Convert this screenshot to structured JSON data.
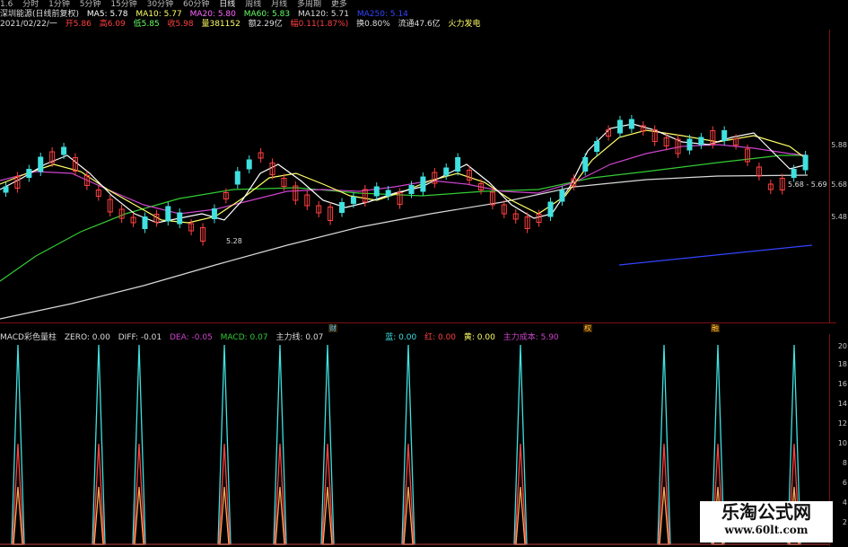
{
  "toolbar": {
    "items": [
      "1.6",
      "分时",
      "1分钟",
      "5分钟",
      "15分钟",
      "30分钟",
      "60分钟",
      "日线",
      "周线",
      "月线",
      "多周期",
      "更多"
    ]
  },
  "price_info": {
    "name": "深圳能源(日线前复权)",
    "ma5": "MA5: 5.78",
    "ma10": "MA10: 5.77",
    "ma20": "MA20: 5.80",
    "ma60": "MA60: 5.83",
    "ma120": "MA120: 5.71",
    "extra": "MA250: 5.14"
  },
  "quote_info": {
    "date": "2021/02/22/一",
    "open": "开5.86",
    "high": "高6.09",
    "low": "低5.85",
    "close": "收5.98",
    "volume": "量381152",
    "amount": "额2.29亿",
    "change": "幅0.11(1.87%)",
    "turnover": "换0.80%",
    "float": "流通47.6亿",
    "sector": "火力发电"
  },
  "chart_labels": {
    "low_marker": "5.28",
    "range_marker": "5.68 - 5.69"
  },
  "right_axis": {
    "upper_ticks": [
      "5.88",
      "5.68",
      "5.48"
    ],
    "lower_ticks": [
      "20",
      "18",
      "16",
      "14",
      "12",
      "10",
      "8",
      "6",
      "4",
      "2"
    ]
  },
  "markers": [
    "财",
    "权",
    "融"
  ],
  "macd_info": {
    "title": "MACD彩色量柱",
    "zero": "ZERO: 0.00",
    "diff": "DIFF: -0.01",
    "dea": "DEA: -0.05",
    "macd": "MACD: 0.07",
    "main": "主力线: 0.07",
    "blue": "蓝: 0.00",
    "red": "红: 0.00",
    "yellow": "黄: 0.00",
    "main_cost": "主力成本: 5.90"
  },
  "watermark": {
    "title": "乐淘公式网",
    "url": "www.60lt.com"
  },
  "colors": {
    "up": "#ff4040",
    "down": "#40e0e0",
    "ma5": "#ffffff",
    "ma10": "#ffff66",
    "ma20": "#ff66ff",
    "ma60": "#66ff66",
    "ma120": "#c0c0c0",
    "ma250": "#3344ff"
  }
}
